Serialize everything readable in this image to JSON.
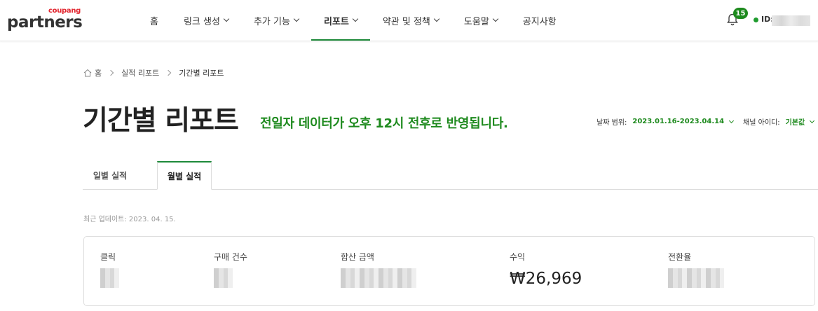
{
  "header": {
    "logo_small": "coupang",
    "logo_main": "partners",
    "nav": [
      {
        "label": "홈",
        "dropdown": false,
        "active": false
      },
      {
        "label": "링크 생성",
        "dropdown": true,
        "active": false
      },
      {
        "label": "추가 기능",
        "dropdown": true,
        "active": false
      },
      {
        "label": "리포트",
        "dropdown": true,
        "active": true
      },
      {
        "label": "약관 및 정책",
        "dropdown": true,
        "active": false
      },
      {
        "label": "도움말",
        "dropdown": true,
        "active": false
      },
      {
        "label": "공지사항",
        "dropdown": false,
        "active": false
      }
    ],
    "notification_count": "15",
    "user_id_label": "ID:"
  },
  "breadcrumb": {
    "home": "홈",
    "parent": "실적 리포트",
    "current": "기간별 리포트"
  },
  "page": {
    "title": "기간별 리포트",
    "notice": "전일자 데이터가 오후 12시 전후로 반영됩니다."
  },
  "filters": {
    "date_label": "날짜 범위:",
    "date_value": "2023.01.16-2023.04.14",
    "channel_label": "채널 아이디:",
    "channel_value": "기본값"
  },
  "tabs": [
    {
      "label": "일별 실적",
      "active": false
    },
    {
      "label": "월별 실적",
      "active": true
    }
  ],
  "last_updated": "최근 업데이트: 2023. 04. 15.",
  "stats": {
    "clicks_label": "클릭",
    "orders_label": "구매 건수",
    "total_amount_label": "합산 금액",
    "revenue_label": "수익",
    "revenue_value": "₩26,969",
    "conversion_label": "전환율"
  },
  "colors": {
    "accent_green": "#1e8a1e",
    "brand_red": "#e2262f"
  }
}
